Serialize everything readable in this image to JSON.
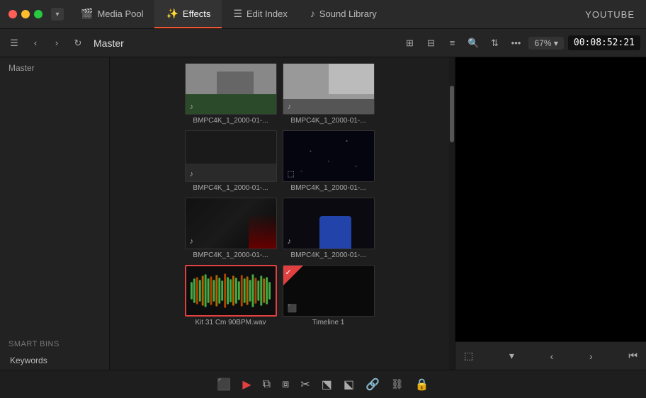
{
  "topbar": {
    "tabs": [
      {
        "id": "media-pool",
        "label": "Media Pool",
        "icon": "🎬",
        "active": false
      },
      {
        "id": "effects",
        "label": "Effects",
        "icon": "✨",
        "active": true
      },
      {
        "id": "edit-index",
        "label": "Edit Index",
        "icon": "☰",
        "active": false
      },
      {
        "id": "sound-library",
        "label": "Sound Library",
        "icon": "♪",
        "active": false
      }
    ],
    "workspace": "YOUTUBE"
  },
  "secondbar": {
    "master_label": "Master",
    "zoom": "67%",
    "timecode": "00:08:52:21"
  },
  "sidebar": {
    "top_label": "Master",
    "sections": [
      {
        "label": "Smart Bins"
      },
      {
        "label": "Keywords"
      }
    ]
  },
  "media_grid": {
    "items": [
      {
        "id": 1,
        "label": "BMPC4K_1_2000-01-...",
        "type": "audio",
        "selected": false
      },
      {
        "id": 2,
        "label": "BMPC4K_1_2000-01-...",
        "type": "audio",
        "selected": false
      },
      {
        "id": 3,
        "label": "BMPC4K_1_2000-01-...",
        "type": "audio",
        "selected": false
      },
      {
        "id": 4,
        "label": "BMPC4K_1_2000-01-...",
        "type": "image",
        "selected": false
      },
      {
        "id": 5,
        "label": "BMPC4K_1_2000-01-...",
        "type": "audio",
        "selected": false
      },
      {
        "id": 6,
        "label": "BMPC4K_1_2000-01-...",
        "type": "audio",
        "selected": false
      },
      {
        "id": 7,
        "label": "Kit 31 Cm 90BPM.wav",
        "type": "waveform",
        "selected": true
      },
      {
        "id": 8,
        "label": "Timeline 1",
        "type": "timeline",
        "selected": false
      }
    ]
  },
  "bottom_bar": {
    "buttons": [
      {
        "id": "monitor-btn",
        "icon": "⬛",
        "active": false
      },
      {
        "id": "arrow-btn",
        "icon": "▶",
        "active": true
      },
      {
        "id": "trim-btn",
        "icon": "⧉",
        "active": false
      },
      {
        "id": "ripple-btn",
        "icon": "⧈",
        "active": false
      },
      {
        "id": "cut-btn",
        "icon": "✂",
        "active": false
      },
      {
        "id": "insert-btn",
        "icon": "⬔",
        "active": false
      },
      {
        "id": "replace-btn",
        "icon": "⬕",
        "active": false
      },
      {
        "id": "link-btn",
        "icon": "🔗",
        "active": false
      },
      {
        "id": "unlink-btn",
        "icon": "⛓",
        "active": false
      },
      {
        "id": "lock-btn",
        "icon": "🔒",
        "active": false
      }
    ]
  },
  "icons": {
    "dropdown": "▾",
    "back": "‹",
    "forward": "›",
    "sync": "↻",
    "grid2": "⊞",
    "grid3": "⊟",
    "list": "≡",
    "search": "🔍",
    "sort": "⇅",
    "more": "•••",
    "music": "♪",
    "image": "⬚",
    "timeline": "⬛",
    "check": "✓"
  }
}
